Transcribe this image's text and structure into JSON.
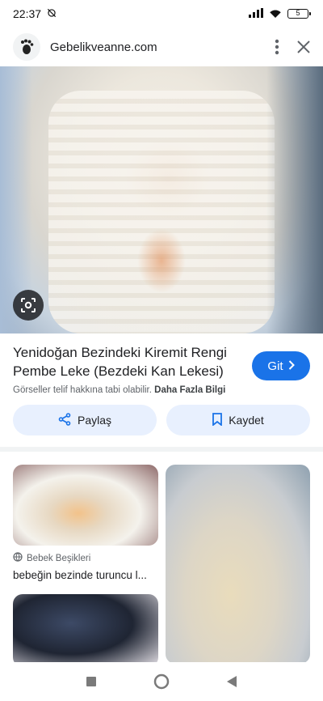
{
  "status_bar": {
    "time": "22:37",
    "battery": "5"
  },
  "header": {
    "site_name": "Gebelikveanne.com"
  },
  "result": {
    "title": "Yenidoğan Bezindeki Kiremit Rengi Pembe Leke (Bezdeki Kan Lekesi)",
    "go_label": "Git",
    "copyright_text": "Görseller telif hakkına tabi olabilir.",
    "more_info_label": "Daha Fazla Bilgi"
  },
  "actions": {
    "share_label": "Paylaş",
    "save_label": "Kaydet"
  },
  "related": [
    {
      "source": "Bebek Beşikleri",
      "caption": "bebeğin bezinde turuncu l..."
    }
  ],
  "colors": {
    "accent": "#1a73e8",
    "pill_bg": "#e8f0fe"
  }
}
